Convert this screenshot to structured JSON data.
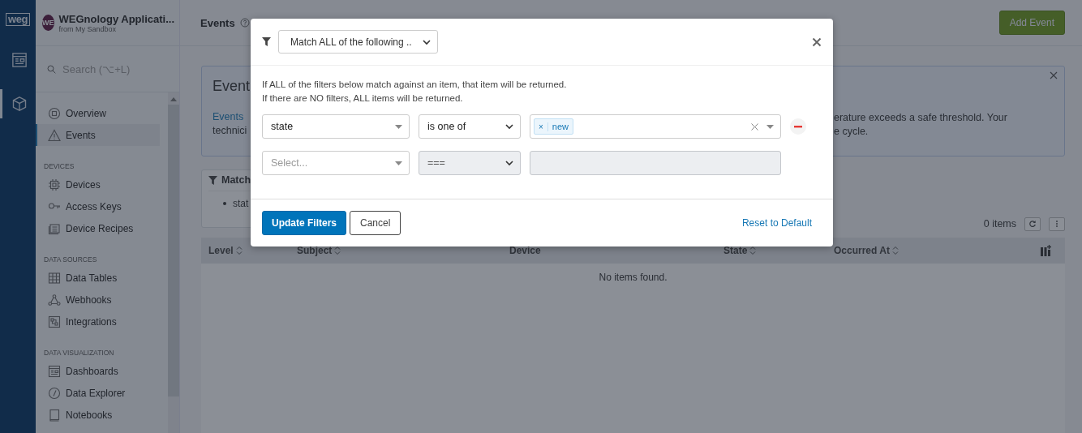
{
  "rail": {
    "logo": "weg",
    "items": [
      {
        "kind": "dashboard",
        "selected": false
      },
      {
        "kind": "cube",
        "selected": true
      }
    ]
  },
  "sidebar": {
    "app": {
      "avatar": "WE",
      "name": "WEGnology Applicati...",
      "subtitle": "from My Sandbox"
    },
    "search": {
      "placeholder": "Search (⌥+L)"
    },
    "sections": [
      {
        "items": [
          {
            "label": "Overview",
            "kind": "overview",
            "selected": false
          },
          {
            "label": "Events",
            "kind": "warning",
            "selected": true
          }
        ]
      },
      {
        "heading": "DEVICES",
        "items": [
          {
            "label": "Devices",
            "kind": "chip",
            "selected": false
          },
          {
            "label": "Access Keys",
            "kind": "key",
            "selected": false
          },
          {
            "label": "Device Recipes",
            "kind": "recipe",
            "selected": false
          }
        ]
      },
      {
        "heading": "DATA SOURCES",
        "items": [
          {
            "label": "Data Tables",
            "kind": "table",
            "selected": false
          },
          {
            "label": "Webhooks",
            "kind": "webhook",
            "selected": false
          },
          {
            "label": "Integrations",
            "kind": "integration",
            "selected": false
          }
        ]
      },
      {
        "heading": "DATA VISUALIZATION",
        "items": [
          {
            "label": "Dashboards",
            "kind": "dashboard",
            "selected": false
          },
          {
            "label": "Data Explorer",
            "kind": "compass",
            "selected": false
          },
          {
            "label": "Notebooks",
            "kind": "notebook",
            "selected": false
          }
        ]
      }
    ]
  },
  "header": {
    "title": "Events",
    "add_button": "Add Event"
  },
  "info": {
    "heading": "Event",
    "left_lines": [
      "Events",
      "technici"
    ],
    "right_lines": [
      "erature exceeds a safe threshold. Your",
      "e cycle."
    ]
  },
  "filter_summary": {
    "title": "Match",
    "items": [
      "stat"
    ]
  },
  "table": {
    "count": "0 items",
    "columns": [
      {
        "label": "Level",
        "sortable": true
      },
      {
        "label": "Subject",
        "sortable": true
      },
      {
        "label": "Device",
        "sortable": false
      },
      {
        "label": "State",
        "sortable": true
      },
      {
        "label": "Occurred At",
        "sortable": true
      }
    ],
    "empty": "No items found."
  },
  "modal": {
    "match_mode": "Match ALL of the following ..",
    "notes": [
      "If ALL of the filters below match against an item, that item will be returned.",
      "If there are NO filters, ALL items will be returned."
    ],
    "filters": [
      {
        "kind": "tags",
        "field": "state",
        "operator": "is one of",
        "values": [
          {
            "remove": "×",
            "label": "new"
          }
        ],
        "disabled": false
      },
      {
        "kind": "text",
        "field_placeholder": "Select...",
        "operator": "===",
        "disabled": true
      }
    ],
    "primary_button": "Update Filters",
    "cancel_button": "Cancel",
    "reset_link": "Reset to Default"
  }
}
